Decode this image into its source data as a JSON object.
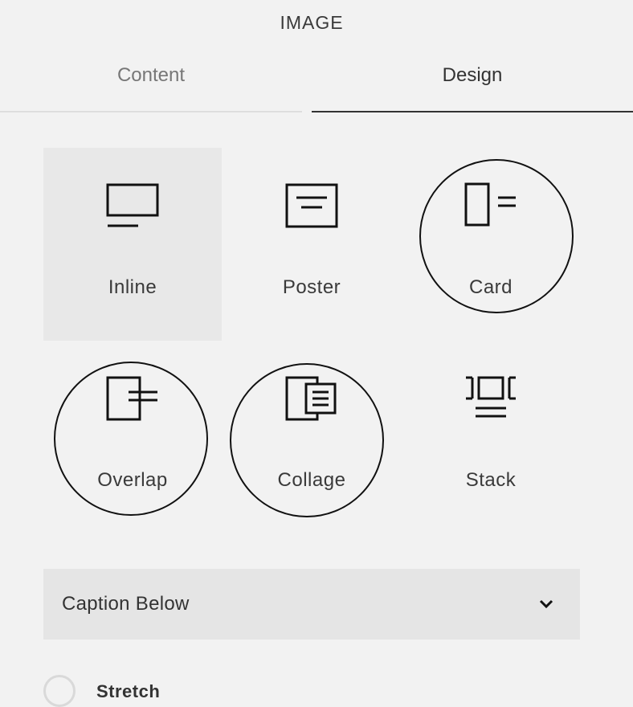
{
  "panel": {
    "title": "IMAGE"
  },
  "tabs": [
    {
      "label": "Content",
      "active": false
    },
    {
      "label": "Design",
      "active": true
    }
  ],
  "layouts": [
    {
      "label": "Inline",
      "icon": "inline-layout-icon",
      "selected": true,
      "ringed": false
    },
    {
      "label": "Poster",
      "icon": "poster-layout-icon",
      "selected": false,
      "ringed": false
    },
    {
      "label": "Card",
      "icon": "card-layout-icon",
      "selected": false,
      "ringed": true
    },
    {
      "label": "Overlap",
      "icon": "overlap-layout-icon",
      "selected": false,
      "ringed": true
    },
    {
      "label": "Collage",
      "icon": "collage-layout-icon",
      "selected": false,
      "ringed": true
    },
    {
      "label": "Stack",
      "icon": "stack-layout-icon",
      "selected": false,
      "ringed": false
    }
  ],
  "caption": {
    "value": "Caption Below",
    "icon": "chevron-down-icon"
  },
  "stretch": {
    "label": "Stretch",
    "checked": false
  },
  "colors": {
    "background": "#f2f2f2",
    "selected_tile": "#e8e8e8",
    "dropdown": "#e5e5e5",
    "text": "#333333",
    "muted_text": "#777777",
    "ring": "#111111"
  }
}
